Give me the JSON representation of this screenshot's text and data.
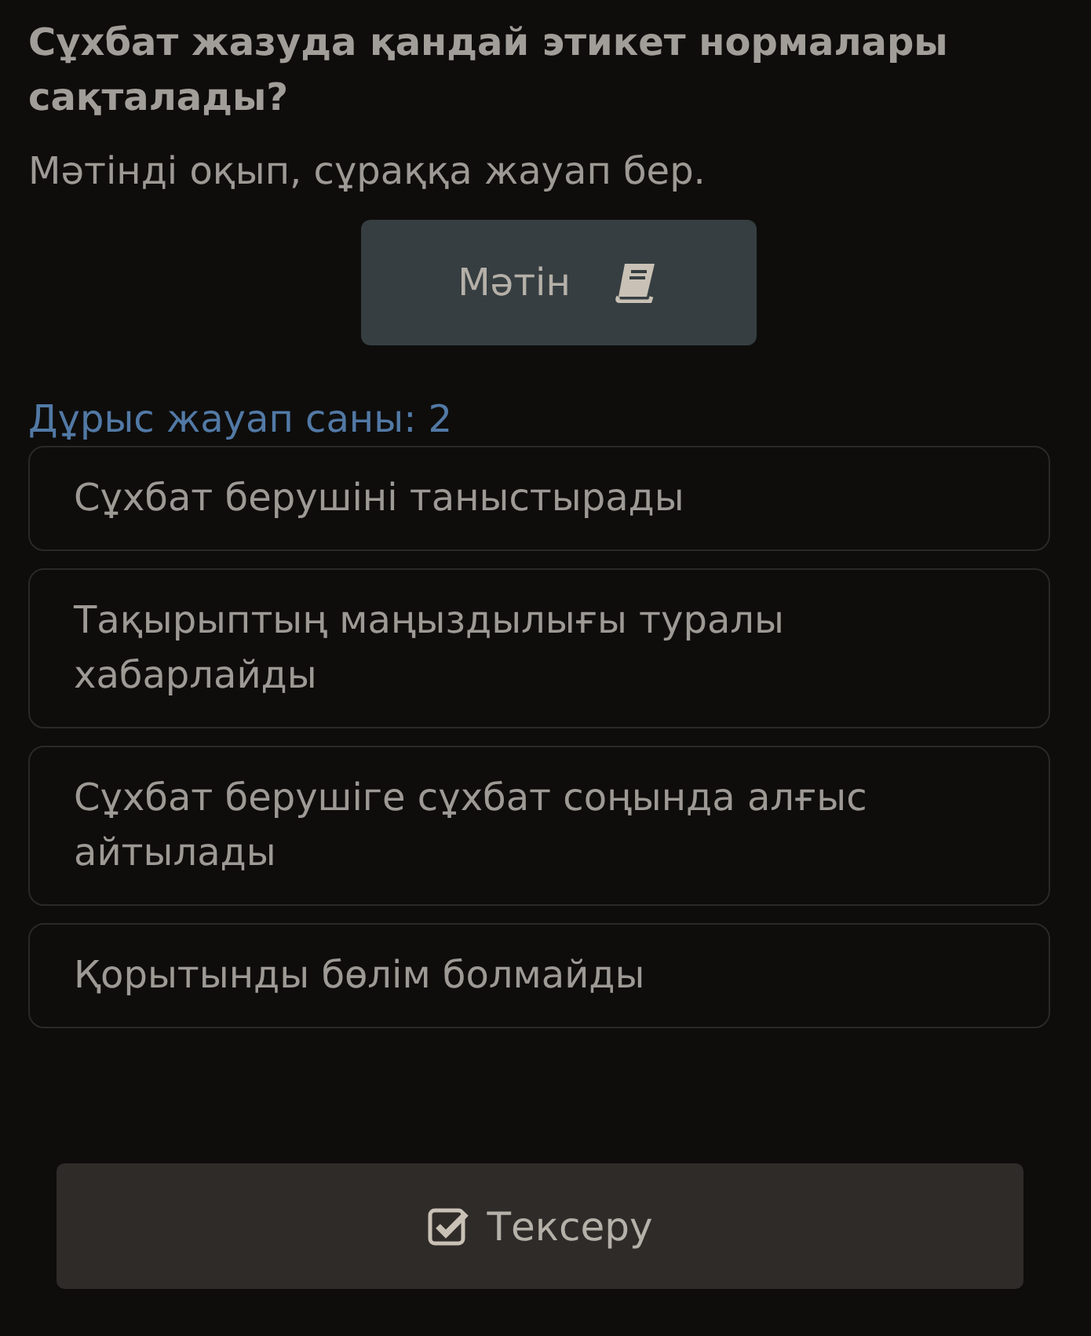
{
  "question": "Сұхбат жазуда қандай этикет нормалары сақталады?",
  "instruction": "Мәтінді оқып, сұраққа жауап бер.",
  "text_button": {
    "label": "Мәтін"
  },
  "answer_count": "Дұрыс жауап саны: 2",
  "options": [
    {
      "label": "Сұхбат берушіні таныстырады",
      "selected": false
    },
    {
      "label": "Тақырыптың маңыздылығы туралы хабарлайды",
      "selected": false
    },
    {
      "label": "Сұхбат берушіге сұхбат соңында алғыс айтылады",
      "selected": false
    },
    {
      "label": "Қорытынды бөлім болмайды",
      "selected": false
    }
  ],
  "check_button": {
    "label": "Тексеру"
  }
}
